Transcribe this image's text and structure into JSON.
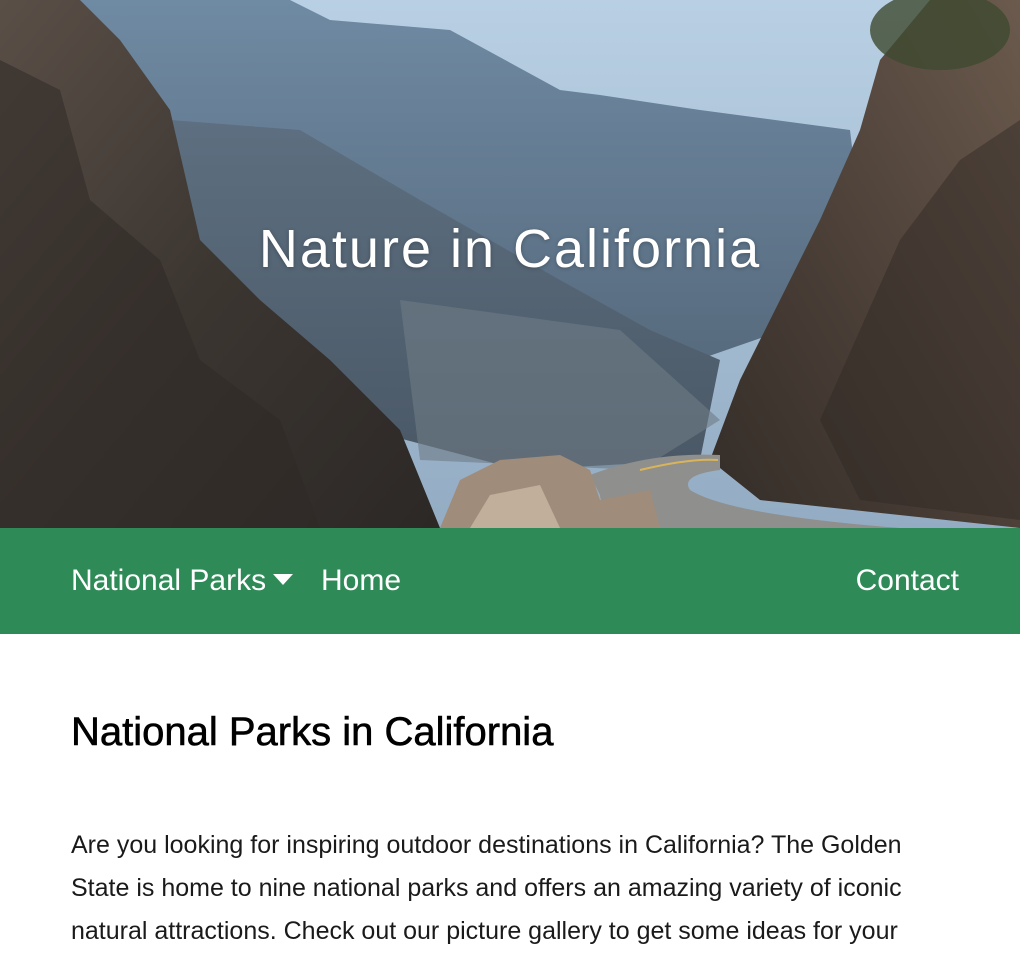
{
  "hero": {
    "title": "Nature in California"
  },
  "nav": {
    "items": [
      {
        "label": "National Parks",
        "has_dropdown": true
      },
      {
        "label": "Home",
        "has_dropdown": false
      }
    ],
    "contact_label": "Contact"
  },
  "main": {
    "heading": "National Parks in California",
    "intro": "Are you looking for inspiring outdoor destinations in California? The Golden State is home to nine national parks and offers an amazing variety of iconic natural attractions. Check out our picture gallery to get some ideas for your"
  },
  "colors": {
    "nav_background": "#2e8b57",
    "nav_text": "#ffffff",
    "heading_text": "#000000"
  },
  "icons": {
    "dropdown": "caret-down-icon"
  }
}
